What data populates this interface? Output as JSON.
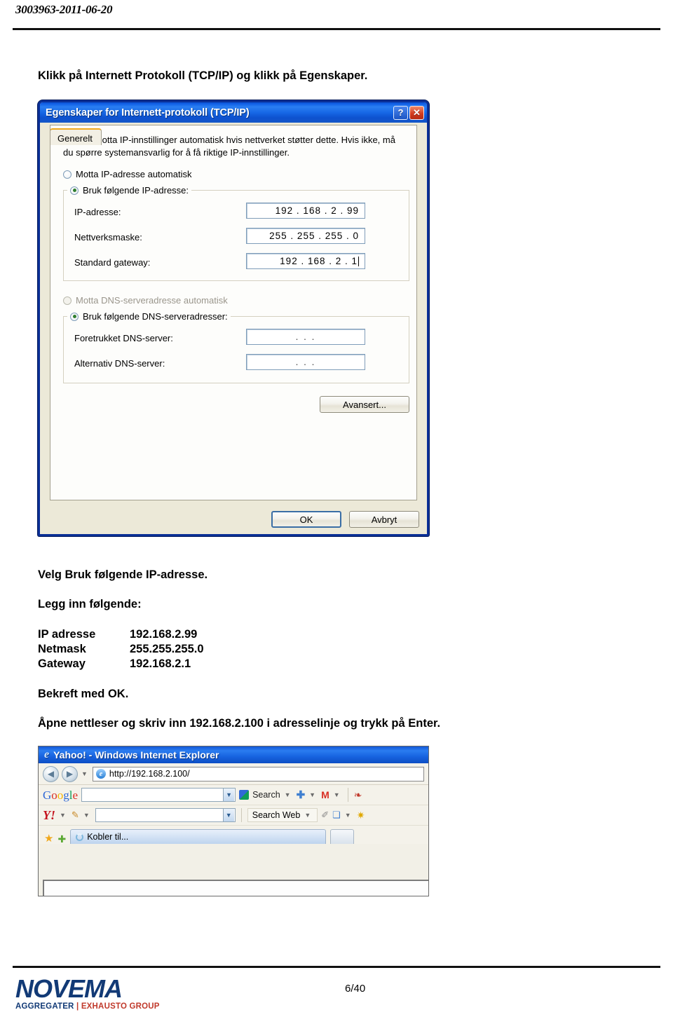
{
  "document": {
    "header_id": "3003963-2011-06-20",
    "page_number": "6/40"
  },
  "instructions": {
    "step1": "Klikk på Internett Protokoll (TCP/IP) og klikk på Egenskaper.",
    "step2": "Velg Bruk følgende IP-adresse.",
    "step3": "Legg inn følgende:",
    "confirm": "Bekreft med OK.",
    "browser_step": "Åpne nettleser og skriv inn 192.168.2.100 i adresselinje og trykk på Enter."
  },
  "settings_table": {
    "rows": [
      {
        "label": "IP adresse",
        "value": "192.168.2.99"
      },
      {
        "label": "Netmask",
        "value": "255.255.255.0"
      },
      {
        "label": "Gateway",
        "value": "192.168.2.1"
      }
    ]
  },
  "tcpip_dialog": {
    "title": "Egenskaper for Internett-protokoll (TCP/IP)",
    "help_button": "?",
    "close_button": "✕",
    "tab": "Generelt",
    "description": "Du kan motta IP-innstillinger automatisk hvis nettverket støtter dette. Hvis ikke, må du spørre systemansvarlig for å få riktige IP-innstillinger.",
    "ip_auto_radio": "Motta IP-adresse automatisk",
    "ip_manual_radio": "Bruk følgende IP-adresse:",
    "ip_address_label": "IP-adresse:",
    "ip_address_value": "192 . 168 .  2  .  99",
    "subnet_label": "Nettverksmaske:",
    "subnet_value": "255 . 255 . 255 .  0",
    "gateway_label": "Standard gateway:",
    "gateway_value": "192 . 168 .  2  .  1",
    "dns_auto_radio": "Motta DNS-serveradresse automatisk",
    "dns_manual_radio": "Bruk følgende DNS-serveradresser:",
    "dns_preferred_label": "Foretrukket DNS-server:",
    "dns_preferred_value": ".    .    .",
    "dns_alternate_label": "Alternativ DNS-server:",
    "dns_alternate_value": ".    .    .",
    "advanced_button": "Avansert...",
    "ok_button": "OK",
    "cancel_button": "Avbryt"
  },
  "browser_window": {
    "title": "Yahoo! - Windows Internet Explorer",
    "address_value": "http://192.168.2.100/",
    "google_toolbar": {
      "logo": [
        "G",
        "o",
        "o",
        "g",
        "l",
        "e"
      ],
      "search_value": "",
      "search_label": "Search",
      "gmail_label": "M"
    },
    "yahoo_toolbar": {
      "logo": "Y!",
      "search_value": "",
      "search_web_label": "Search Web"
    },
    "tab_label": "Kobler til..."
  },
  "footer": {
    "logo_word": "NOVEMA",
    "logo_sub_left": "AGGREGATER",
    "logo_sub_sep": "|",
    "logo_sub_right": "EXHAUSTO GROUP"
  },
  "colors": {
    "xp_title_blue": "#1262e8",
    "dialog_face": "#ece9d8",
    "logo_blue": "#123a76",
    "logo_red": "#c0392b"
  }
}
